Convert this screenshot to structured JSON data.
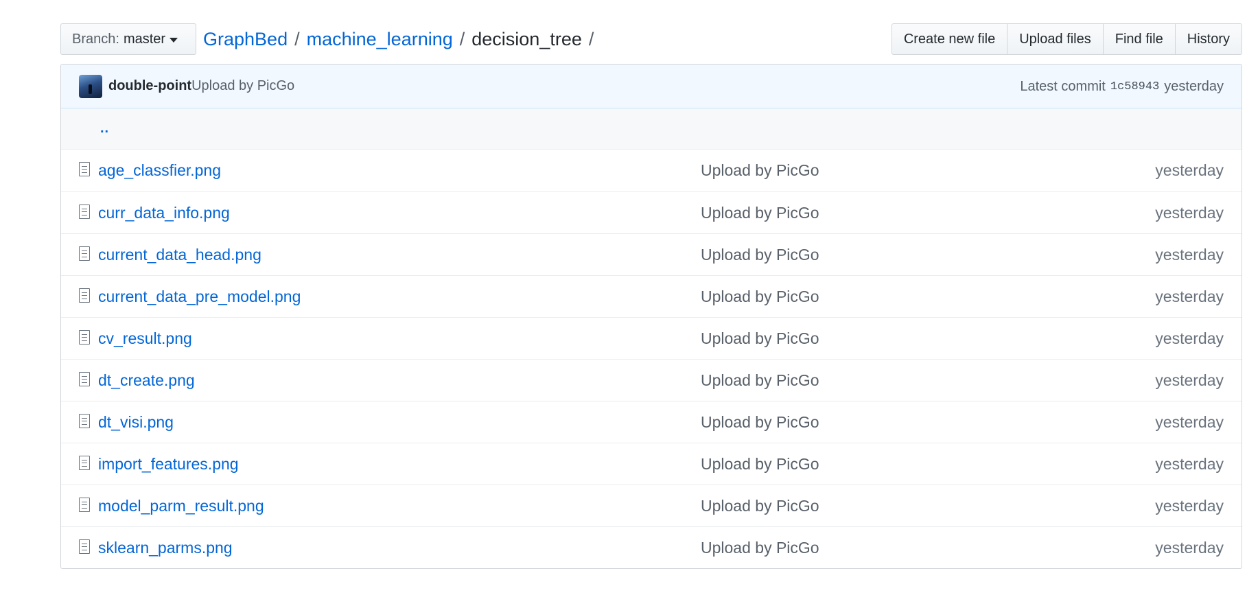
{
  "branch": {
    "prefix": "Branch:",
    "name": "master"
  },
  "breadcrumb": {
    "repo": "GraphBed",
    "folder": "machine_learning",
    "current": "decision_tree",
    "separator": "/"
  },
  "actions": {
    "create": "Create new file",
    "upload": "Upload files",
    "find": "Find file",
    "history": "History"
  },
  "commit": {
    "author": "double-point",
    "message": "Upload by PicGo",
    "latest_label": "Latest commit",
    "sha": "1c58943",
    "age": "yesterday"
  },
  "up_link": "..",
  "files": [
    {
      "name": "age_classfier.png",
      "message": "Upload by PicGo",
      "age": "yesterday"
    },
    {
      "name": "curr_data_info.png",
      "message": "Upload by PicGo",
      "age": "yesterday"
    },
    {
      "name": "current_data_head.png",
      "message": "Upload by PicGo",
      "age": "yesterday"
    },
    {
      "name": "current_data_pre_model.png",
      "message": "Upload by PicGo",
      "age": "yesterday"
    },
    {
      "name": "cv_result.png",
      "message": "Upload by PicGo",
      "age": "yesterday"
    },
    {
      "name": "dt_create.png",
      "message": "Upload by PicGo",
      "age": "yesterday"
    },
    {
      "name": "dt_visi.png",
      "message": "Upload by PicGo",
      "age": "yesterday"
    },
    {
      "name": "import_features.png",
      "message": "Upload by PicGo",
      "age": "yesterday"
    },
    {
      "name": "model_parm_result.png",
      "message": "Upload by PicGo",
      "age": "yesterday"
    },
    {
      "name": "sklearn_parms.png",
      "message": "Upload by PicGo",
      "age": "yesterday"
    }
  ],
  "colors": {
    "link": "#0366d6",
    "commit_bar_bg": "#f1f8ff",
    "muted_text": "#586069"
  }
}
